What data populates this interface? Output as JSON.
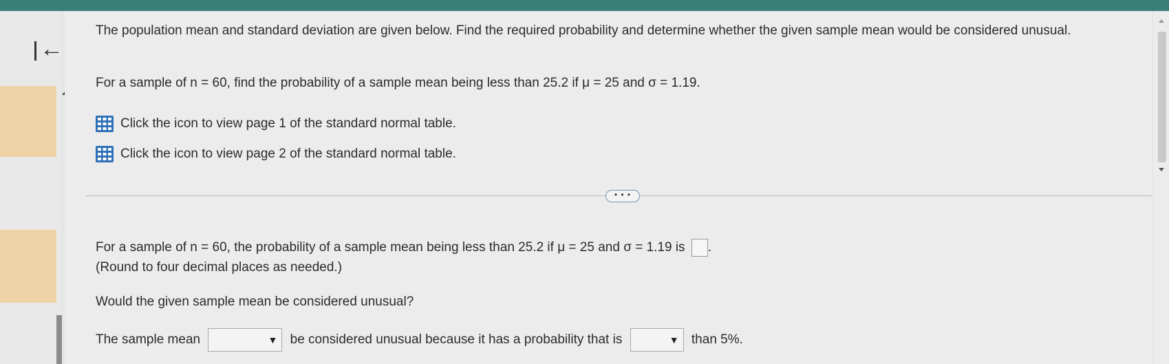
{
  "question": {
    "intro": "The population mean and standard deviation are given below. Find the required probability and determine whether the given sample mean would be considered unusual.",
    "prompt": "For a sample of n = 60, find the probability of a sample mean being less than 25.2 if μ = 25 and σ = 1.19."
  },
  "links": [
    {
      "icon": "table-icon",
      "label": "Click the icon to view page 1 of the standard normal table."
    },
    {
      "icon": "table-icon",
      "label": "Click the icon to view page 2 of the standard normal table."
    }
  ],
  "more_button": "• • •",
  "answer": {
    "statement": "For a sample of n = 60, the probability of a sample mean being less than 25.2 if μ = 25 and σ = 1.19 is",
    "statement_end": ".",
    "box_value": "",
    "round_note": "(Round to four decimal places as needed.)",
    "question2": "Would the given sample mean be considered unusual?",
    "sentence_part1": "The sample mean",
    "dropdown1_value": "",
    "sentence_part2": "be considered unusual because it has a probability that is",
    "dropdown2_value": "",
    "sentence_part3": "than 5%."
  },
  "icons": {
    "back": "back-to-start-icon",
    "dropdown_caret": "caret-down-icon",
    "table": "table-icon"
  },
  "colors": {
    "top_bar": "#3a7f78",
    "stripe": "#edd3a5",
    "table_icon": "#2e6fb7"
  }
}
